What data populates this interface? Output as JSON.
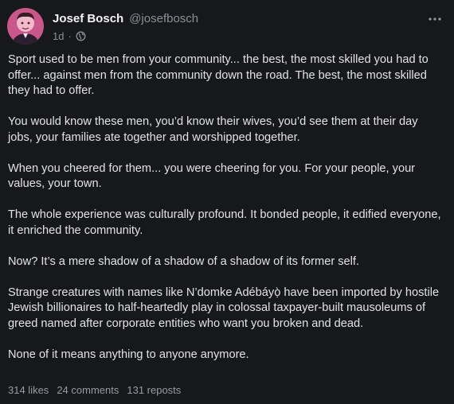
{
  "post": {
    "author": {
      "display_name": "Josef Bosch",
      "handle": "@josefbosch"
    },
    "meta": {
      "age": "1d",
      "separator": "·",
      "visibility_icon": "globe-icon"
    },
    "menu_icon": "more-horizontal-icon",
    "paragraphs": [
      "Sport used to be men from your community... the best, the most skilled you had to offer... against men from the community down the road. The best, the most skilled they had to offer.",
      "You would know these men, you’d know their wives, you’d see them at their day jobs, your families ate together and worshipped together.",
      "When you cheered for them... you were cheering for you. For your people, your values, your town.",
      "The whole experience was culturally profound. It bonded people, it edified everyone, it enriched the community.",
      "Now? It’s a mere shadow of a shadow of a shadow of its former self.",
      "Strange creatures with names like N’domke Adébáyọ̀ have been imported by hostile Jewish billionaires to half-heartedly play in colossal taxpayer-built mausoleums of greed named after corporate entities who want you broken and dead.",
      "None of it means anything to anyone anymore."
    ],
    "stats": {
      "likes": "314 likes",
      "comments": "24 comments",
      "reposts": "131 reposts"
    }
  }
}
